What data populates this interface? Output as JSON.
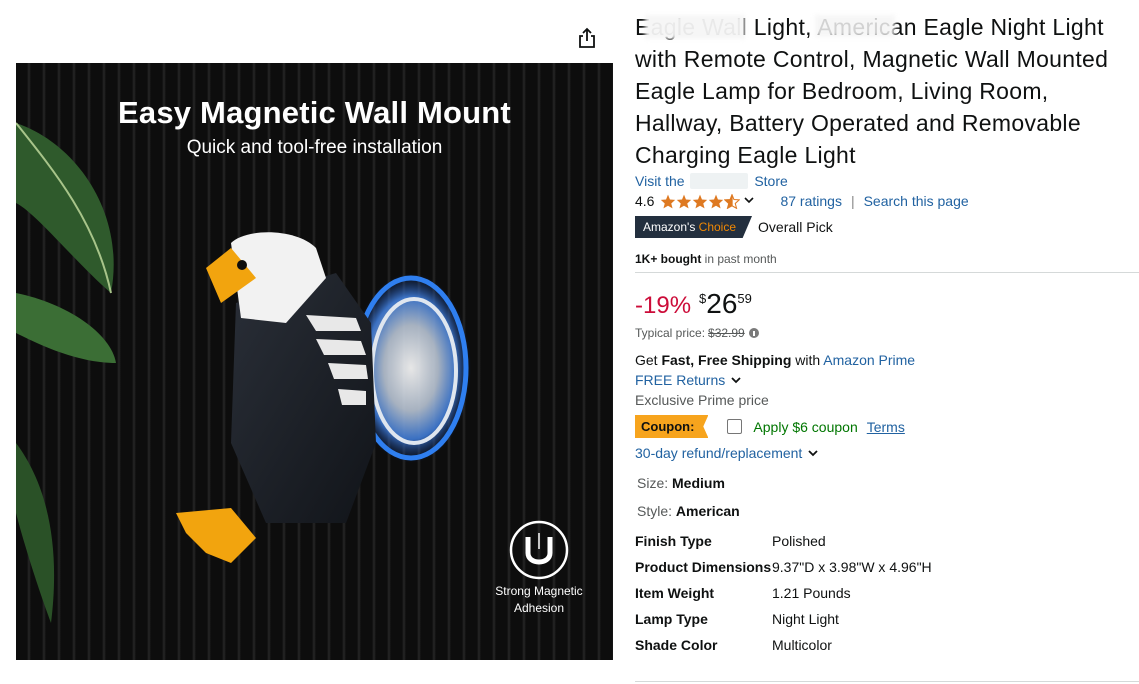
{
  "product": {
    "title": "Eagle Wall Light, American Eagle Night Light with Remote Control, Magnetic Wall Mounted Eagle Lamp for Bedroom, Living Room, Hallway, Battery Operated and Removable Charging Eagle Light",
    "store_prefix": "Visit the",
    "store_suffix": "Store",
    "rating_value": "4.6",
    "ratings_count": "87 ratings",
    "search_page": "Search this page",
    "choice_label_1": "Amazon's",
    "choice_label_2": "Choice",
    "choice_text": "Overall Pick",
    "bought_bold": "1K+ bought",
    "bought_rest": " in past month"
  },
  "pricing": {
    "discount": "-19%",
    "currency": "$",
    "whole": "26",
    "fraction": "59",
    "typical_label": "Typical price:",
    "typical_price": "$32.99"
  },
  "shipping": {
    "get": "Get ",
    "bold": "Fast, Free Shipping",
    "with": " with ",
    "prime_link": "Amazon Prime",
    "returns": "FREE Returns",
    "exclusive": "Exclusive Prime price"
  },
  "coupon": {
    "badge": "Coupon:",
    "apply": "Apply $6 coupon",
    "terms": "Terms"
  },
  "refund": "30-day refund/replacement",
  "variations": {
    "size_label": "Size: ",
    "size_value": "Medium",
    "style_label": "Style: ",
    "style_value": "American"
  },
  "specs": [
    {
      "key": "Finish Type",
      "value": "Polished"
    },
    {
      "key": "Product Dimensions",
      "value": "9.37\"D x 3.98\"W x 4.96\"H"
    },
    {
      "key": "Item Weight",
      "value": "1.21 Pounds"
    },
    {
      "key": "Lamp Type",
      "value": "Night Light"
    },
    {
      "key": "Shade Color",
      "value": "Multicolor"
    }
  ],
  "hero_image": {
    "title": "Easy Magnetic Wall Mount",
    "subtitle": "Quick and tool-free installation",
    "badge_line1": "Strong Magnetic",
    "badge_line2": "Adhesion"
  },
  "icons": {
    "share": "share-icon",
    "star": "star-icon",
    "chevron": "chevron-down-icon",
    "info": "info-icon",
    "magnet": "magnet-icon"
  },
  "colors": {
    "link": "#2162a1",
    "discount": "#cc0c39",
    "star": "#de7921",
    "coupon": "#f7a41d",
    "choice_bg": "#232f3e"
  }
}
